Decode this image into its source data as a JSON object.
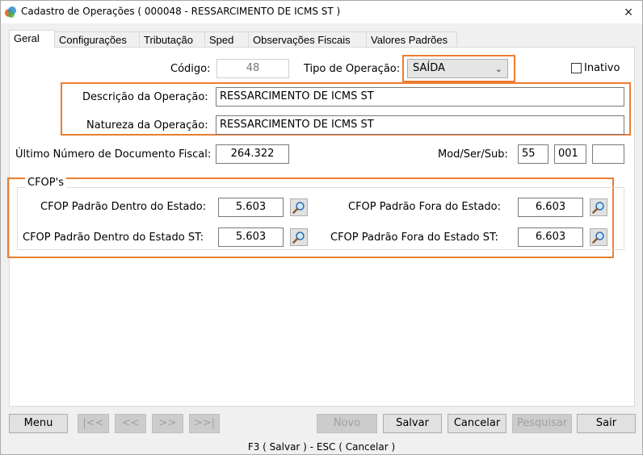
{
  "window": {
    "title": "Cadastro de Operações ( 000048 - RESSARCIMENTO DE ICMS ST )",
    "close_icon": "×"
  },
  "tabs": [
    {
      "label": "Geral",
      "active": true
    },
    {
      "label": "Configurações"
    },
    {
      "label": "Tributação"
    },
    {
      "label": "Sped"
    },
    {
      "label": "Observações Fiscais"
    },
    {
      "label": "Valores Padrões"
    }
  ],
  "form": {
    "codigo_label": "Código:",
    "codigo_value": "48",
    "tipo_operacao_label": "Tipo de Operação:",
    "tipo_operacao_value": "SAÍDA",
    "inativo_label": "Inativo",
    "inativo_checked": false,
    "descricao_label": "Descrição da Operação:",
    "descricao_value": "RESSARCIMENTO DE ICMS ST",
    "natureza_label": "Natureza da Operação:",
    "natureza_value": "RESSARCIMENTO DE ICMS ST",
    "ultimo_numero_label": "Último Número de Documento Fiscal:",
    "ultimo_numero_value": "264.322",
    "mod_ser_sub_label": "Mod/Ser/Sub:",
    "mod_value": "55",
    "ser_value": "001",
    "sub_value": ""
  },
  "cfop": {
    "group_title": "CFOP's",
    "dentro_estado_label": "CFOP Padrão Dentro do Estado:",
    "dentro_estado_value": "5.603",
    "fora_estado_label": "CFOP Padrão Fora do Estado:",
    "fora_estado_value": "6.603",
    "dentro_estado_st_label": "CFOP Padrão Dentro do Estado ST:",
    "dentro_estado_st_value": "5.603",
    "fora_estado_st_label": "CFOP Padrão Fora do Estado ST:",
    "fora_estado_st_value": "6.603"
  },
  "buttons": {
    "menu": "Menu",
    "first": "|<<",
    "prev": "<<",
    "next": ">>",
    "last": ">>|",
    "novo": "Novo",
    "salvar": "Salvar",
    "cancelar": "Cancelar",
    "pesquisar": "Pesquisar",
    "sair": "Sair"
  },
  "status": {
    "shortcuts": "F3 ( Salvar )  -  ESC ( Cancelar )"
  },
  "colors": {
    "highlight": "#ed7d31"
  }
}
